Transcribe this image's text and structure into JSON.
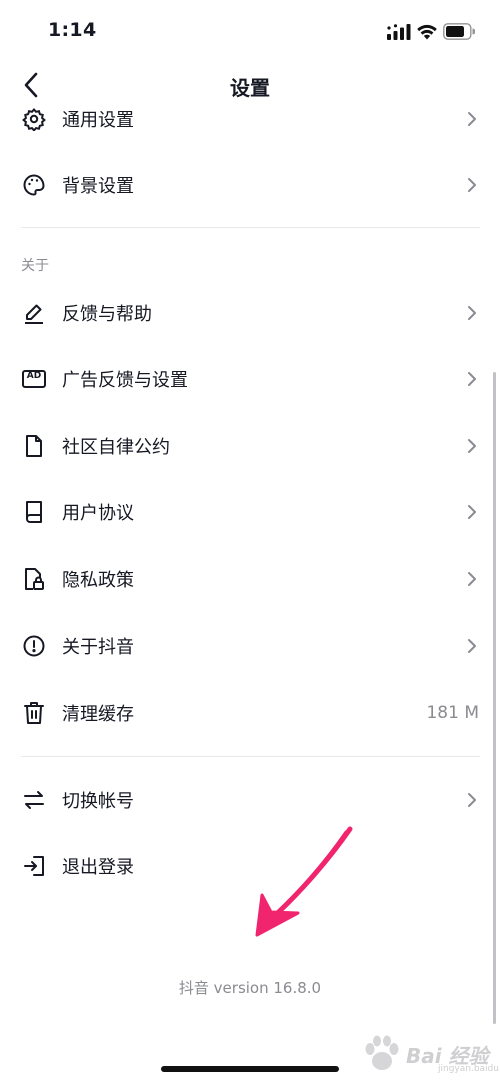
{
  "status_bar": {
    "time": "1:14"
  },
  "nav": {
    "title": "设置"
  },
  "rows_top": [
    {
      "label": "通用设置",
      "icon": "gear-icon"
    },
    {
      "label": "背景设置",
      "icon": "palette-icon"
    }
  ],
  "section_about": {
    "header": "关于"
  },
  "rows_about": [
    {
      "label": "反馈与帮助",
      "icon": "pencil-icon"
    },
    {
      "label": "广告反馈与设置",
      "icon": "ad-icon",
      "icon_text": "AD"
    },
    {
      "label": "社区自律公约",
      "icon": "document-icon"
    },
    {
      "label": "用户协议",
      "icon": "book-icon"
    },
    {
      "label": "隐私政策",
      "icon": "lock-document-icon"
    },
    {
      "label": "关于抖音",
      "icon": "info-exclamation-icon"
    },
    {
      "label": "清理缓存",
      "icon": "trash-icon",
      "value": "181 M"
    }
  ],
  "rows_account": [
    {
      "label": "切换帐号",
      "icon": "switch-arrows-icon"
    },
    {
      "label": "退出登录",
      "icon": "logout-icon"
    }
  ],
  "footer": {
    "version": "抖音 version 16.8.0"
  },
  "watermark": {
    "text": "Bai 经验",
    "sub": "jingyan.baidu.com"
  },
  "colors": {
    "annotation_arrow": "#f0256e",
    "secondary_text": "#8a8b91",
    "primary_text": "#161823"
  }
}
